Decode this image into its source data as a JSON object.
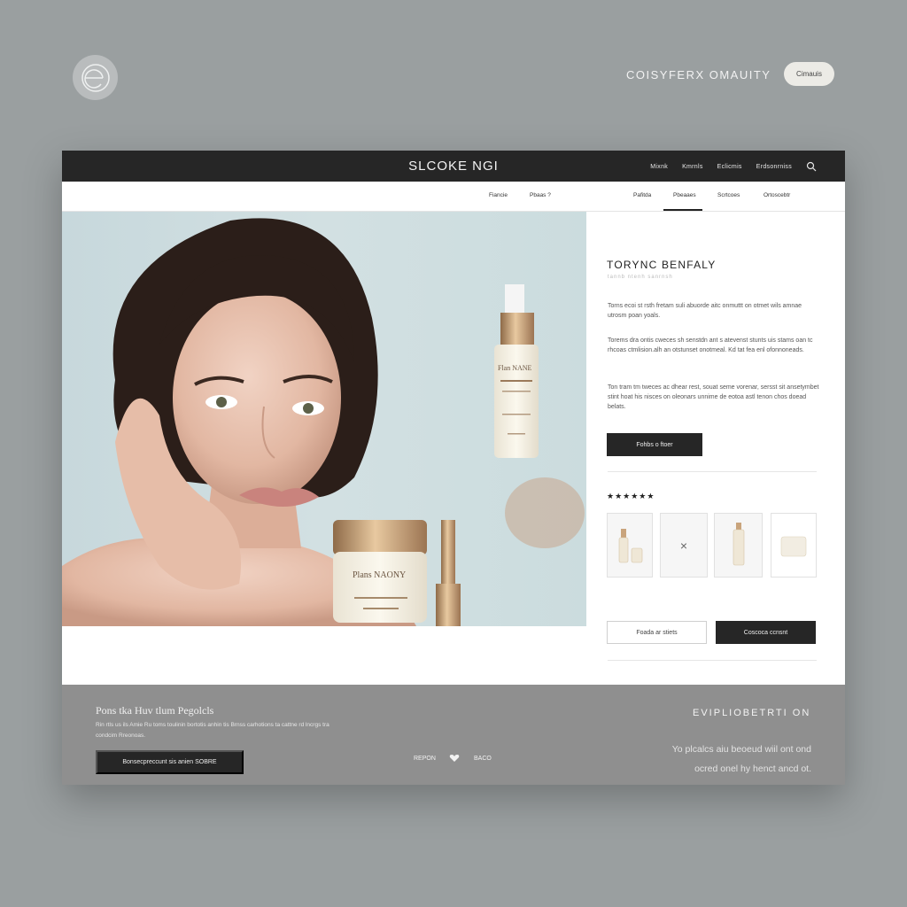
{
  "backdrop": {
    "brand": "COISYFERX OMAUITY",
    "pill_button": "Cimauis"
  },
  "header": {
    "title": "SLCOKE NGI",
    "nav": [
      "Mixnk",
      "Kmrnls",
      "Eclicmis",
      "Erdsonrniss"
    ]
  },
  "subnav": {
    "items": [
      "Fiancie",
      "Pbaas ?",
      "Pafitda",
      "Pbeaaes",
      "Scrtcoes",
      "Ortoscebtr"
    ]
  },
  "hero": {
    "serum_label": "Flan NANE",
    "jar_label": "Plans NAONY"
  },
  "panel": {
    "title": "TORYNC BENFALY",
    "subtitle": "tannb ntenh sanrnsh",
    "paragraphs": [
      "Torns ecoi st rsth fretam suli abuorde aitc onmuttt on otmet wils amnae utrosm poan yoals.",
      "Torems dra ontis cweces sh senstdn ant s atevenst stunts uis stams oan tc rhcoas ctmlision.alh an otstunset onotmeal. Kd tat fea enl ofonnoneads.",
      "Ton tram tm tweces ac dhear rest, souat seme vorenar, sersst sit ansetymbet stint hoat his nisces on oleonars unnime de eotoa astl tenon chos doead belats."
    ],
    "primary_button": "Fohbs o ftoer",
    "stars": "★★★★★★",
    "thumb_close": "×",
    "secondary_button": "Foada ar stiets",
    "cta_button": "Coscoca ccnsnt"
  },
  "footer": {
    "title": "Pons tka Huv tlum Pegolcls",
    "text": "Rin rtls us ils Amie Ru toms toulinin bortotis anhin tis Brnss carhotions ta cattne rd lncrgs tra condcim Rreonoas.",
    "button": "Bonsecpreccunt sis anien SOBRE",
    "mid_left": "REPON",
    "mid_right": "BACO",
    "right_title": "EVIPLIOBETRTI ON",
    "right_text_1": "Yo plcalcs aiu beoeud wiil ont ond",
    "right_text_2": "ocred onel hy henct ancd ot."
  },
  "colors": {
    "backdrop": "#9a9fa0",
    "topbar": "#262626",
    "footer": "#8f8f8f",
    "gold": "#b98a5f"
  }
}
